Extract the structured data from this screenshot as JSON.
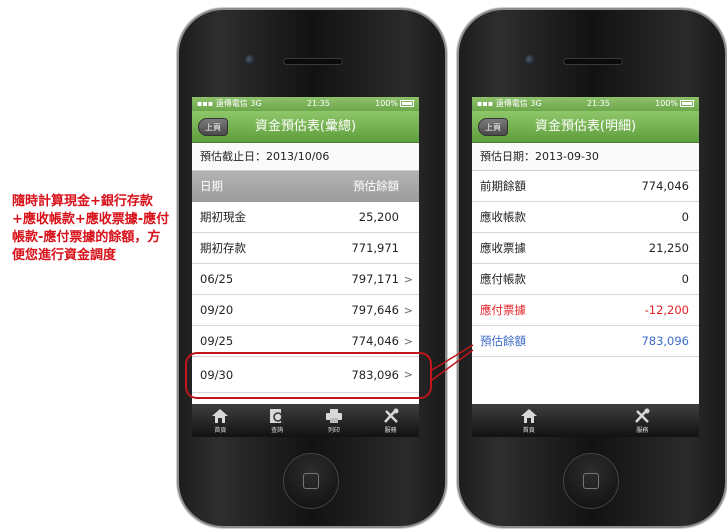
{
  "annotation": "隨時計算現金+銀行存款+應收帳款+應收票據-應付帳款-應付票據的餘額，方便您進行資金調度",
  "status": {
    "carrier": "遠傳電信",
    "network": "3G",
    "time": "21:35",
    "battery": "100%"
  },
  "left": {
    "back": "上頁",
    "title": "資金預估表(彙總)",
    "subheader": "預估截止日：2013/10/06",
    "columns": {
      "date": "日期",
      "amount": "預估餘額"
    },
    "rows": [
      {
        "label": "期初現金",
        "value": "25,200"
      },
      {
        "label": "期初存款",
        "value": "771,971"
      },
      {
        "label": "06/25",
        "value": "797,171"
      },
      {
        "label": "09/20",
        "value": "797,646"
      },
      {
        "label": "09/25",
        "value": "774,046"
      },
      {
        "label": "09/30",
        "value": "783,096"
      }
    ],
    "tabs": [
      {
        "label": "首頁",
        "icon": "home-icon"
      },
      {
        "label": "查詢",
        "icon": "search-icon"
      },
      {
        "label": "列印",
        "icon": "printer-icon"
      },
      {
        "label": "服務",
        "icon": "tools-icon"
      }
    ]
  },
  "right": {
    "back": "上頁",
    "title": "資金預估表(明細)",
    "subheader": "預估日期：2013-09-30",
    "rows": [
      {
        "label": "前期餘額",
        "value": "774,046"
      },
      {
        "label": "應收帳款",
        "value": "0"
      },
      {
        "label": "應收票據",
        "value": "21,250"
      },
      {
        "label": "應付帳款",
        "value": "0"
      },
      {
        "label": "應付票據",
        "value": "-12,200"
      },
      {
        "label": "預估餘額",
        "value": "783,096"
      }
    ],
    "tabs": [
      {
        "label": "首頁",
        "icon": "home-icon"
      },
      {
        "label": "服務",
        "icon": "tools-icon"
      }
    ]
  },
  "colors": {
    "accent_green": "#6da74c",
    "negative_red": "#e41f24",
    "total_blue": "#3d6cc8",
    "callout_red": "#c0151c"
  }
}
